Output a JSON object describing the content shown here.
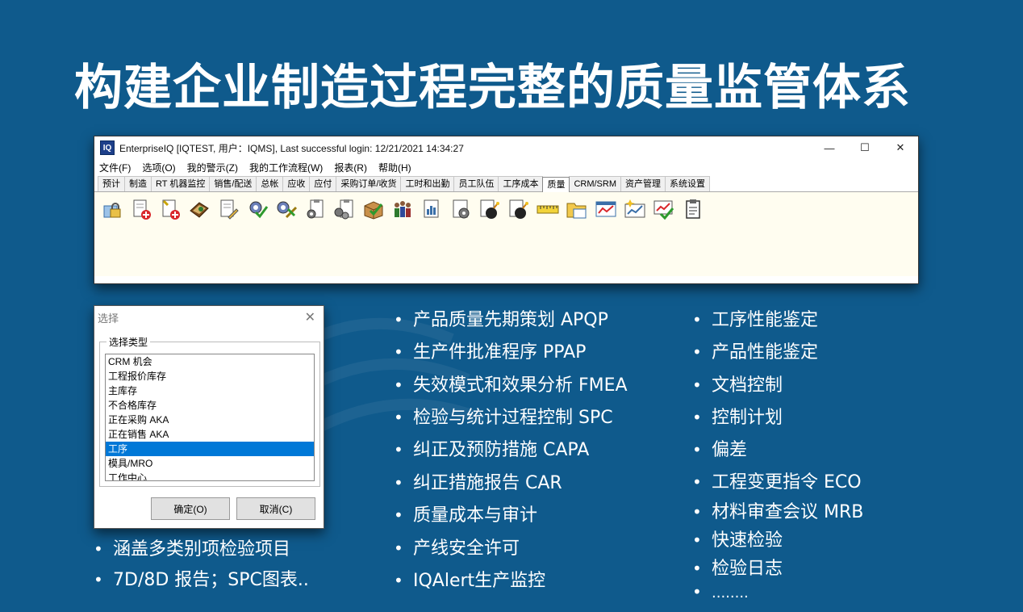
{
  "slide": {
    "title": "构建企业制造过程完整的质量监管体系"
  },
  "app_window": {
    "logo": "IQ",
    "title": "EnterpriseIQ [IQTEST, 用户：IQMS], Last successful login: 12/21/2021 14:34:27",
    "controls": {
      "minimize": "—",
      "maximize": "☐",
      "close": "✕"
    },
    "menu": [
      "文件(F)",
      "选项(O)",
      "我的警示(Z)",
      "我的工作流程(W)",
      "报表(R)",
      "帮助(H)"
    ],
    "tabs": [
      "预计",
      "制造",
      "RT 机器监控",
      "销售/配送",
      "总帐",
      "应收",
      "应付",
      "采购订单/收货",
      "工时和出勤",
      "员工队伍",
      "工序成本",
      "质量",
      "CRM/SRM",
      "资产管理",
      "系统设置"
    ],
    "active_tab": "质量",
    "toolbar_icons": [
      "lock-doc-icon",
      "doc-add-icon",
      "doc-add-icon",
      "book-icon",
      "doc-edit-icon",
      "gear-check-icon",
      "gear-tools-icon",
      "clipboard-gear-icon",
      "clipboard-gears-icon",
      "box-check-icon",
      "people-icon",
      "chart-doc-icon",
      "gear-doc-icon",
      "bomb-icon",
      "bomb-icon",
      "ruler-icon",
      "folder-icon",
      "chart-window-icon",
      "chart-spark-icon",
      "chart-check-icon",
      "clipboard-icon"
    ]
  },
  "dialog": {
    "title": "选择",
    "close": "✕",
    "group_label": "选择类型",
    "items": [
      "CRM 机会",
      "工程报价库存",
      "主库存",
      "不合格库存",
      "正在采购 AKA",
      "正在销售 AKA",
      "工序",
      "模具/MRO",
      "工作中心"
    ],
    "selected": "工序",
    "ok": "确定(O)",
    "cancel": "取消(C)"
  },
  "bullets_bottom_left": [
    "涵盖多类别项检验项目",
    "7D/8D 报告；SPC图表.."
  ],
  "bullets_middle": [
    "产品质量先期策划 APQP",
    "生产件批准程序 PPAP",
    "失效模式和效果分析 FMEA",
    "检验与统计过程控制 SPC",
    "纠正及预防措施 CAPA",
    "纠正措施报告 CAR",
    "质量成本与审计",
    "产线安全许可",
    "IQAlert生产监控"
  ],
  "bullets_right": [
    "工序性能鉴定",
    "产品性能鉴定",
    "文档控制",
    "控制计划",
    "偏差",
    "工程变更指令 ECO",
    "材料审查会议 MRB",
    "快速检验",
    "检验日志",
    "........"
  ],
  "bullet_glyph": "•"
}
